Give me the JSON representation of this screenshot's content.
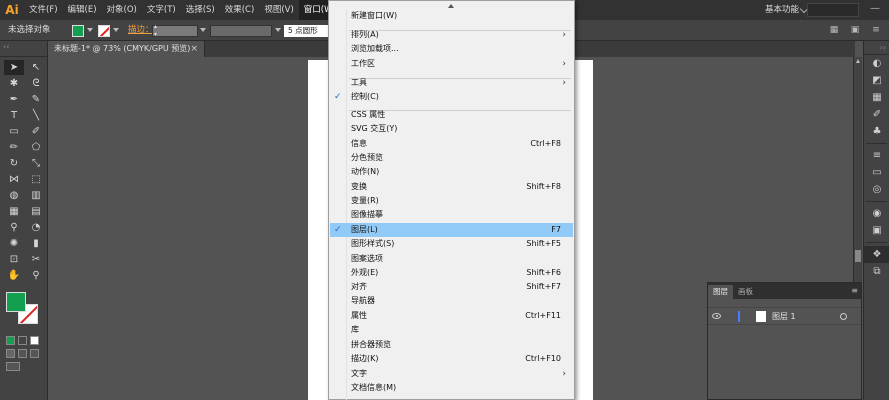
{
  "app": {
    "logo": "Ai"
  },
  "menubar": {
    "items": [
      {
        "label": "文件(F)"
      },
      {
        "label": "编辑(E)"
      },
      {
        "label": "对象(O)"
      },
      {
        "label": "文字(T)"
      },
      {
        "label": "选择(S)"
      },
      {
        "label": "效果(C)"
      },
      {
        "label": "视图(V)"
      },
      {
        "label": "窗口(W)"
      }
    ],
    "workspace": "基本功能",
    "minimize_glyph": "—"
  },
  "controlbar": {
    "selection_label": "未选择对象",
    "stroke_label": "描边：",
    "stroke_points": "5 点圆形",
    "colors": {
      "fill": "#12a050",
      "stroke_slash": "#e02020"
    }
  },
  "document": {
    "tab_title": "未标题-1* @ 73% (CMYK/GPU 预览)",
    "close_glyph": "×"
  },
  "window_menu": {
    "items": [
      {
        "type": "item",
        "label": "新建窗口(W)",
        "shortcut": "",
        "submenu": false,
        "checked": false,
        "highlighted": false
      },
      {
        "type": "sep"
      },
      {
        "type": "item",
        "label": "排列(A)",
        "shortcut": "",
        "submenu": true,
        "checked": false,
        "highlighted": false
      },
      {
        "type": "item",
        "label": "浏览加载项...",
        "shortcut": "",
        "submenu": false,
        "checked": false,
        "highlighted": false
      },
      {
        "type": "item",
        "label": "工作区",
        "shortcut": "",
        "submenu": true,
        "checked": false,
        "highlighted": false
      },
      {
        "type": "sep"
      },
      {
        "type": "item",
        "label": "工具",
        "shortcut": "",
        "submenu": true,
        "checked": false,
        "highlighted": false
      },
      {
        "type": "item",
        "label": "控制(C)",
        "shortcut": "",
        "submenu": false,
        "checked": true,
        "highlighted": false
      },
      {
        "type": "sep"
      },
      {
        "type": "item",
        "label": "CSS 属性",
        "shortcut": "",
        "submenu": false,
        "checked": false,
        "highlighted": false
      },
      {
        "type": "item",
        "label": "SVG 交互(Y)",
        "shortcut": "",
        "submenu": false,
        "checked": false,
        "highlighted": false
      },
      {
        "type": "item",
        "label": "信息",
        "shortcut": "Ctrl+F8",
        "submenu": false,
        "checked": false,
        "highlighted": false
      },
      {
        "type": "item",
        "label": "分色预览",
        "shortcut": "",
        "submenu": false,
        "checked": false,
        "highlighted": false
      },
      {
        "type": "item",
        "label": "动作(N)",
        "shortcut": "",
        "submenu": false,
        "checked": false,
        "highlighted": false
      },
      {
        "type": "item",
        "label": "变换",
        "shortcut": "Shift+F8",
        "submenu": false,
        "checked": false,
        "highlighted": false
      },
      {
        "type": "item",
        "label": "变量(R)",
        "shortcut": "",
        "submenu": false,
        "checked": false,
        "highlighted": false
      },
      {
        "type": "item",
        "label": "图像描摹",
        "shortcut": "",
        "submenu": false,
        "checked": false,
        "highlighted": false
      },
      {
        "type": "item",
        "label": "图层(L)",
        "shortcut": "F7",
        "submenu": false,
        "checked": true,
        "highlighted": true
      },
      {
        "type": "item",
        "label": "图形样式(S)",
        "shortcut": "Shift+F5",
        "submenu": false,
        "checked": false,
        "highlighted": false
      },
      {
        "type": "item",
        "label": "图案选项",
        "shortcut": "",
        "submenu": false,
        "checked": false,
        "highlighted": false
      },
      {
        "type": "item",
        "label": "外观(E)",
        "shortcut": "Shift+F6",
        "submenu": false,
        "checked": false,
        "highlighted": false
      },
      {
        "type": "item",
        "label": "对齐",
        "shortcut": "Shift+F7",
        "submenu": false,
        "checked": false,
        "highlighted": false
      },
      {
        "type": "item",
        "label": "导航器",
        "shortcut": "",
        "submenu": false,
        "checked": false,
        "highlighted": false
      },
      {
        "type": "item",
        "label": "属性",
        "shortcut": "Ctrl+F11",
        "submenu": false,
        "checked": false,
        "highlighted": false
      },
      {
        "type": "item",
        "label": "库",
        "shortcut": "",
        "submenu": false,
        "checked": false,
        "highlighted": false
      },
      {
        "type": "item",
        "label": "拼合器预览",
        "shortcut": "",
        "submenu": false,
        "checked": false,
        "highlighted": false
      },
      {
        "type": "item",
        "label": "描边(K)",
        "shortcut": "Ctrl+F10",
        "submenu": false,
        "checked": false,
        "highlighted": false
      },
      {
        "type": "item",
        "label": "文字",
        "shortcut": "",
        "submenu": true,
        "checked": false,
        "highlighted": false
      },
      {
        "type": "item",
        "label": "文档信息(M)",
        "shortcut": "",
        "submenu": false,
        "checked": false,
        "highlighted": false
      }
    ]
  },
  "layers_panel": {
    "tabs": [
      "图层",
      "画板"
    ],
    "layer_name": "图层 1",
    "layer_color": "#4b7bff"
  },
  "tools": [
    "selection-tool",
    "direct-selection-tool",
    "magic-wand-tool",
    "lasso-tool",
    "pen-tool",
    "curvature-tool",
    "type-tool",
    "line-segment-tool",
    "rectangle-tool",
    "paintbrush-tool",
    "pencil-tool",
    "shaper-tool",
    "rotate-tool",
    "scale-tool",
    "width-tool",
    "free-transform-tool",
    "shape-builder-tool",
    "perspective-grid-tool",
    "mesh-tool",
    "gradient-tool",
    "eyedropper-tool",
    "blend-tool",
    "symbol-sprayer-tool",
    "column-graph-tool",
    "artboard-tool",
    "slice-tool",
    "hand-tool",
    "zoom-tool"
  ]
}
